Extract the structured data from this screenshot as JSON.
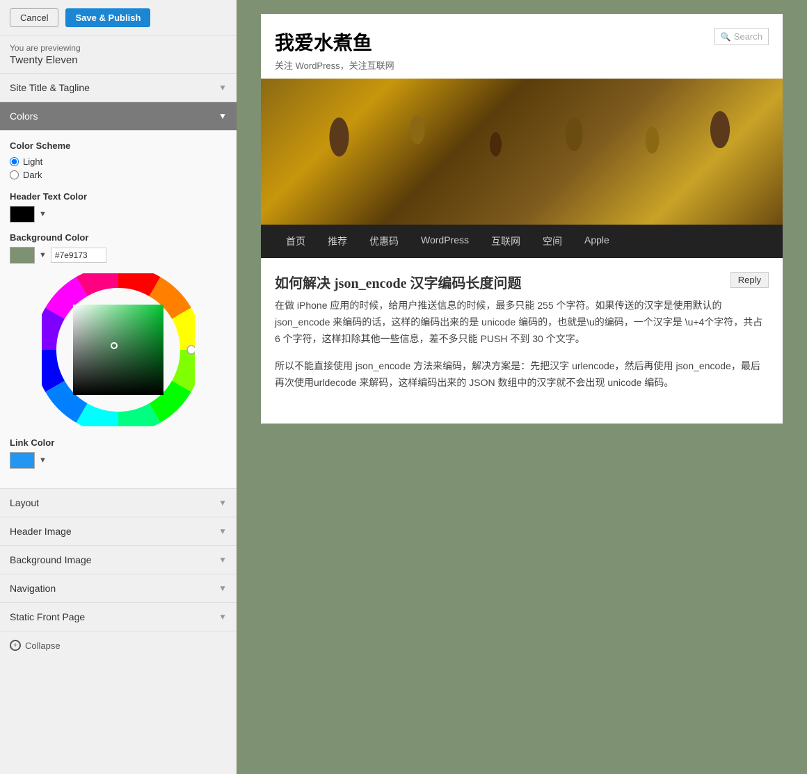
{
  "topbar": {
    "cancel_label": "Cancel",
    "save_label": "Save & Publish",
    "previewing_label": "You are previewing",
    "theme_name": "Twenty Eleven"
  },
  "sidebar": {
    "site_title_section": "Site Title & Tagline",
    "colors_section": "Colors",
    "layout_section": "Layout",
    "header_image_section": "Header Image",
    "background_image_section": "Background Image",
    "navigation_section": "Navigation",
    "static_front_page_section": "Static Front Page",
    "collapse_label": "Collapse"
  },
  "colors_panel": {
    "scheme_label": "Color Scheme",
    "light_label": "Light",
    "dark_label": "Dark",
    "header_text_color_label": "Header Text Color",
    "header_text_color_value": "#000000",
    "background_color_label": "Background Color",
    "background_color_value": "#7e9173",
    "background_color_hex": "#7e9173",
    "link_color_label": "Link Color",
    "link_color_value": "#2196F3"
  },
  "preview": {
    "site_title": "我爱水煮鱼",
    "site_tagline": "关注 WordPress，关注互联网",
    "search_placeholder": "Search",
    "nav_items": [
      "首页",
      "推荐",
      "优惠码",
      "WordPress",
      "互联网",
      "空间",
      "Apple"
    ],
    "post_title": "如何解决 json_encode 汉字编码长度问题",
    "reply_label": "Reply",
    "post_para1": "在做 iPhone 应用的时候，给用户推送信息的时候，最多只能 255 个字符。如果传送的汉字是使用默认的 json_encode 来编码的话，这样的编码出来的是 unicode 编码的，也就是\\u的编码，一个汉字是 \\u+4个字符，共占 6 个字符，这样扣除其他一些信息，差不多只能 PUSH 不到 30 个文字。",
    "post_para2": "所以不能直接使用 json_encode 方法来编码，解决方案是：先把汉字 urlencode，然后再使用 json_encode，最后再次使用urldecode 来解码，这样编码出来的 JSON 数组中的汉字就不会出现 unicode 编码。"
  }
}
